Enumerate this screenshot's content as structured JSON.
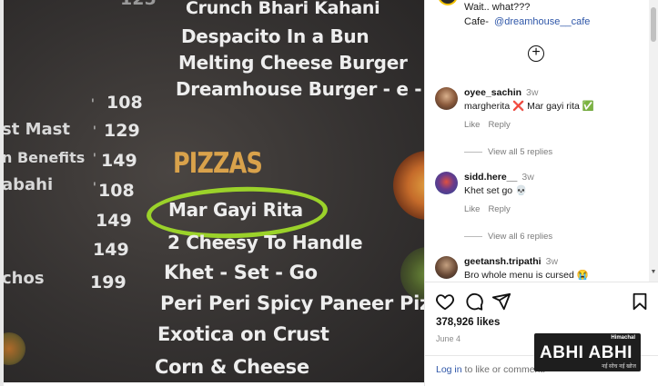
{
  "photo": {
    "menu_top_items": [
      "Crunch Bhari Kahani",
      "Despacito In a Bun",
      "Melting Cheese Burger",
      "Dreamhouse Burger - e - k"
    ],
    "left_items": [
      "st Mast",
      "n Benefits",
      "abahi",
      "chos"
    ],
    "left_prices": [
      "108",
      "129",
      "149",
      "108",
      "149",
      "149",
      "199"
    ],
    "top_cut_price": "125",
    "section_heading": "PIZZAS",
    "pizza_items": [
      "Mar Gayi Rita",
      "2 Cheesy To Handle",
      "Khet - Set - Go",
      "Peri Peri Spicy Paneer Piz",
      "Exotica on Crust",
      "Corn & Cheese"
    ]
  },
  "post": {
    "caption_line1": "Wait.. what???",
    "caption_prefix": "Cafe-",
    "caption_handle": "@dreamhouse__cafe"
  },
  "comments": [
    {
      "user": "oyee_sachin",
      "time": "3w",
      "text": "margherita ❌ Mar gayi rita ✅",
      "like": "Like",
      "reply": "Reply",
      "view_replies": "View all 5 replies"
    },
    {
      "user": "sidd.here__",
      "time": "3w",
      "text": "Khet set go 💀",
      "like": "Like",
      "reply": "Reply",
      "view_replies": "View all 6 replies"
    },
    {
      "user": "geetansh.tripathi",
      "time": "3w",
      "text": "Bro whole menu is cursed 😭"
    }
  ],
  "actions": {
    "icons": [
      "heart-icon",
      "comment-icon",
      "share-icon",
      "bookmark-icon"
    ]
  },
  "likes": "378,926 likes",
  "date": "June 4",
  "login": {
    "link": "Log in",
    "rest": "to like or comment."
  },
  "watermark": {
    "small": "Himachal",
    "main": "ABHI ABHI",
    "sub": "नई सोच नई खोज"
  },
  "colors": {
    "highlight_ellipse": "#9bd22a",
    "pizzas_heading": "#d9a24b",
    "link_blue": "#2e56a8"
  }
}
